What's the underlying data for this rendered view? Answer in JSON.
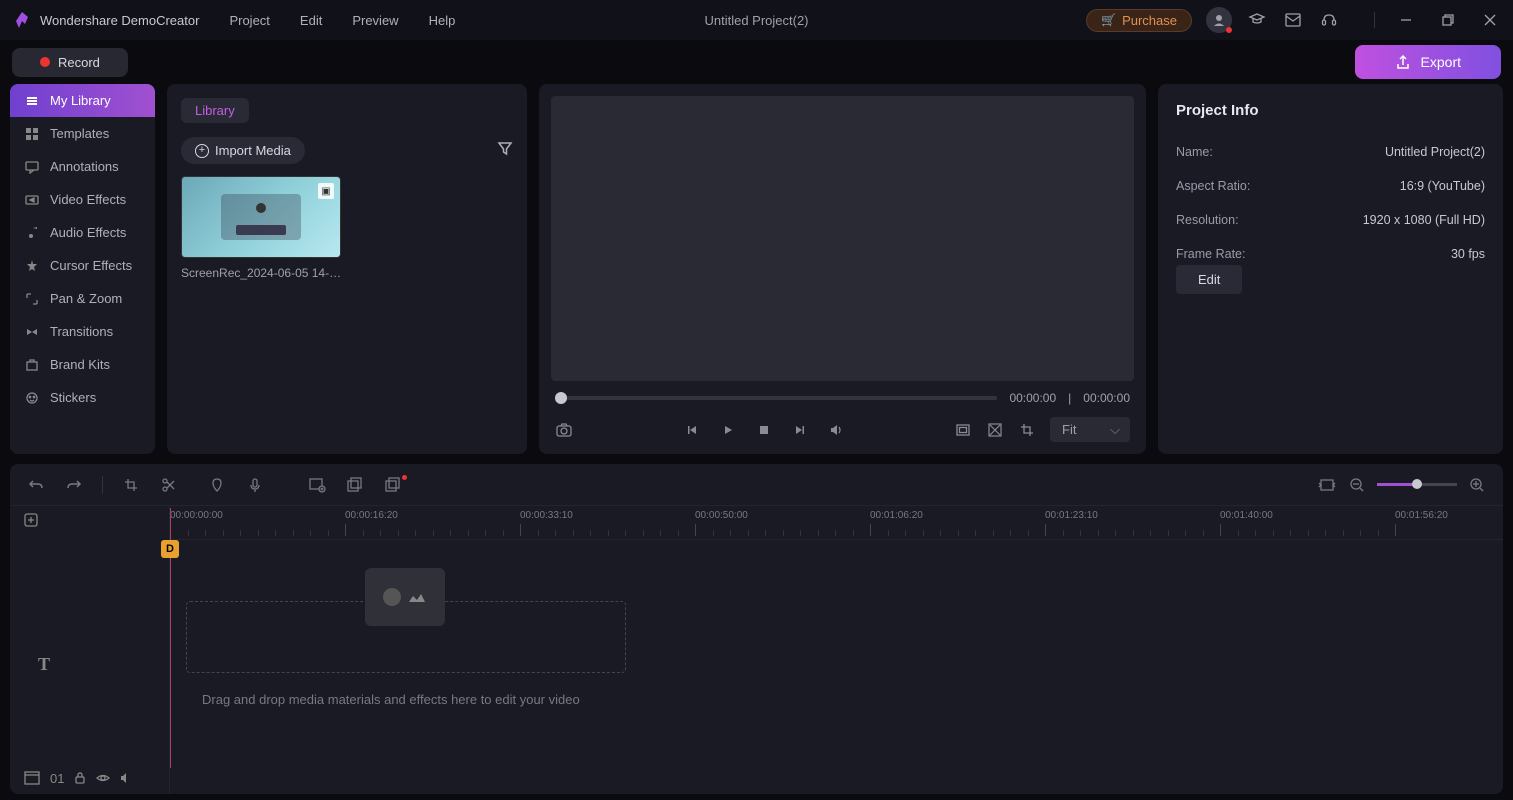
{
  "app": {
    "name": "Wondershare DemoCreator",
    "title": "Untitled Project(2)"
  },
  "menu": {
    "project": "Project",
    "edit": "Edit",
    "preview": "Preview",
    "help": "Help"
  },
  "titleButtons": {
    "purchase": "Purchase"
  },
  "toolbar": {
    "record": "Record",
    "export": "Export"
  },
  "sidebar": {
    "myLibrary": "My Library",
    "templates": "Templates",
    "annotations": "Annotations",
    "videoEffects": "Video Effects",
    "audioEffects": "Audio Effects",
    "cursorEffects": "Cursor Effects",
    "panZoom": "Pan & Zoom",
    "transitions": "Transitions",
    "brandKits": "Brand Kits",
    "stickers": "Stickers"
  },
  "library": {
    "tab": "Library",
    "importMedia": "Import Media",
    "mediaName": "ScreenRec_2024-06-05 14-1…"
  },
  "preview": {
    "currentTime": "00:00:00",
    "totalTime": "00:00:00",
    "fit": "Fit"
  },
  "info": {
    "title": "Project Info",
    "nameLabel": "Name:",
    "nameValue": "Untitled Project(2)",
    "aspectLabel": "Aspect Ratio:",
    "aspectValue": "16:9 (YouTube)",
    "resolutionLabel": "Resolution:",
    "resolutionValue": "1920 x 1080 (Full HD)",
    "framerateLabel": "Frame Rate:",
    "framerateValue": "30 fps",
    "edit": "Edit"
  },
  "timeline": {
    "ticks": [
      "00:00:00:00",
      "00:00:16:20",
      "00:00:33:10",
      "00:00:50:00",
      "00:01:06:20",
      "00:01:23:10",
      "00:01:40:00",
      "00:01:56:20"
    ],
    "playheadLabel": "D",
    "hint": "Drag and drop media materials and effects here to edit your video",
    "trackNumber": "01"
  }
}
